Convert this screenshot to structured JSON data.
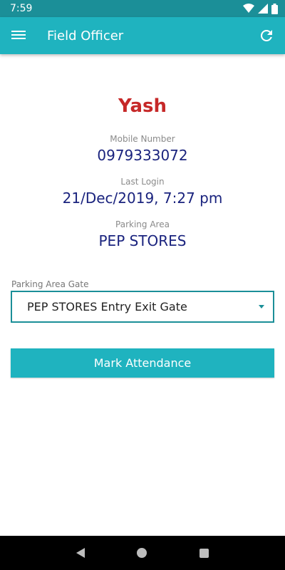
{
  "status_bar": {
    "time": "7:59",
    "icons": [
      "wifi-icon",
      "signal-icon",
      "battery-icon"
    ]
  },
  "app_bar": {
    "title": "Field Officer",
    "left_icon": "menu-icon",
    "right_icon": "refresh-icon",
    "color": "#1fb3bf"
  },
  "profile": {
    "name": "Yash",
    "mobile_label": "Mobile Number",
    "mobile_value": "0979333072",
    "last_login_label": "Last Login",
    "last_login_value": "21/Dec/2019, 7:27 pm",
    "parking_area_label": "Parking Area",
    "parking_area_value": "PEP STORES"
  },
  "gate": {
    "label": "Parking Area Gate",
    "selected": "PEP STORES Entry Exit Gate"
  },
  "actions": {
    "mark_attendance": "Mark Attendance"
  },
  "colors": {
    "name": "#c62828",
    "value": "#1a237e",
    "accent": "#1fb3bf",
    "status_bar": "#1b8f98"
  }
}
